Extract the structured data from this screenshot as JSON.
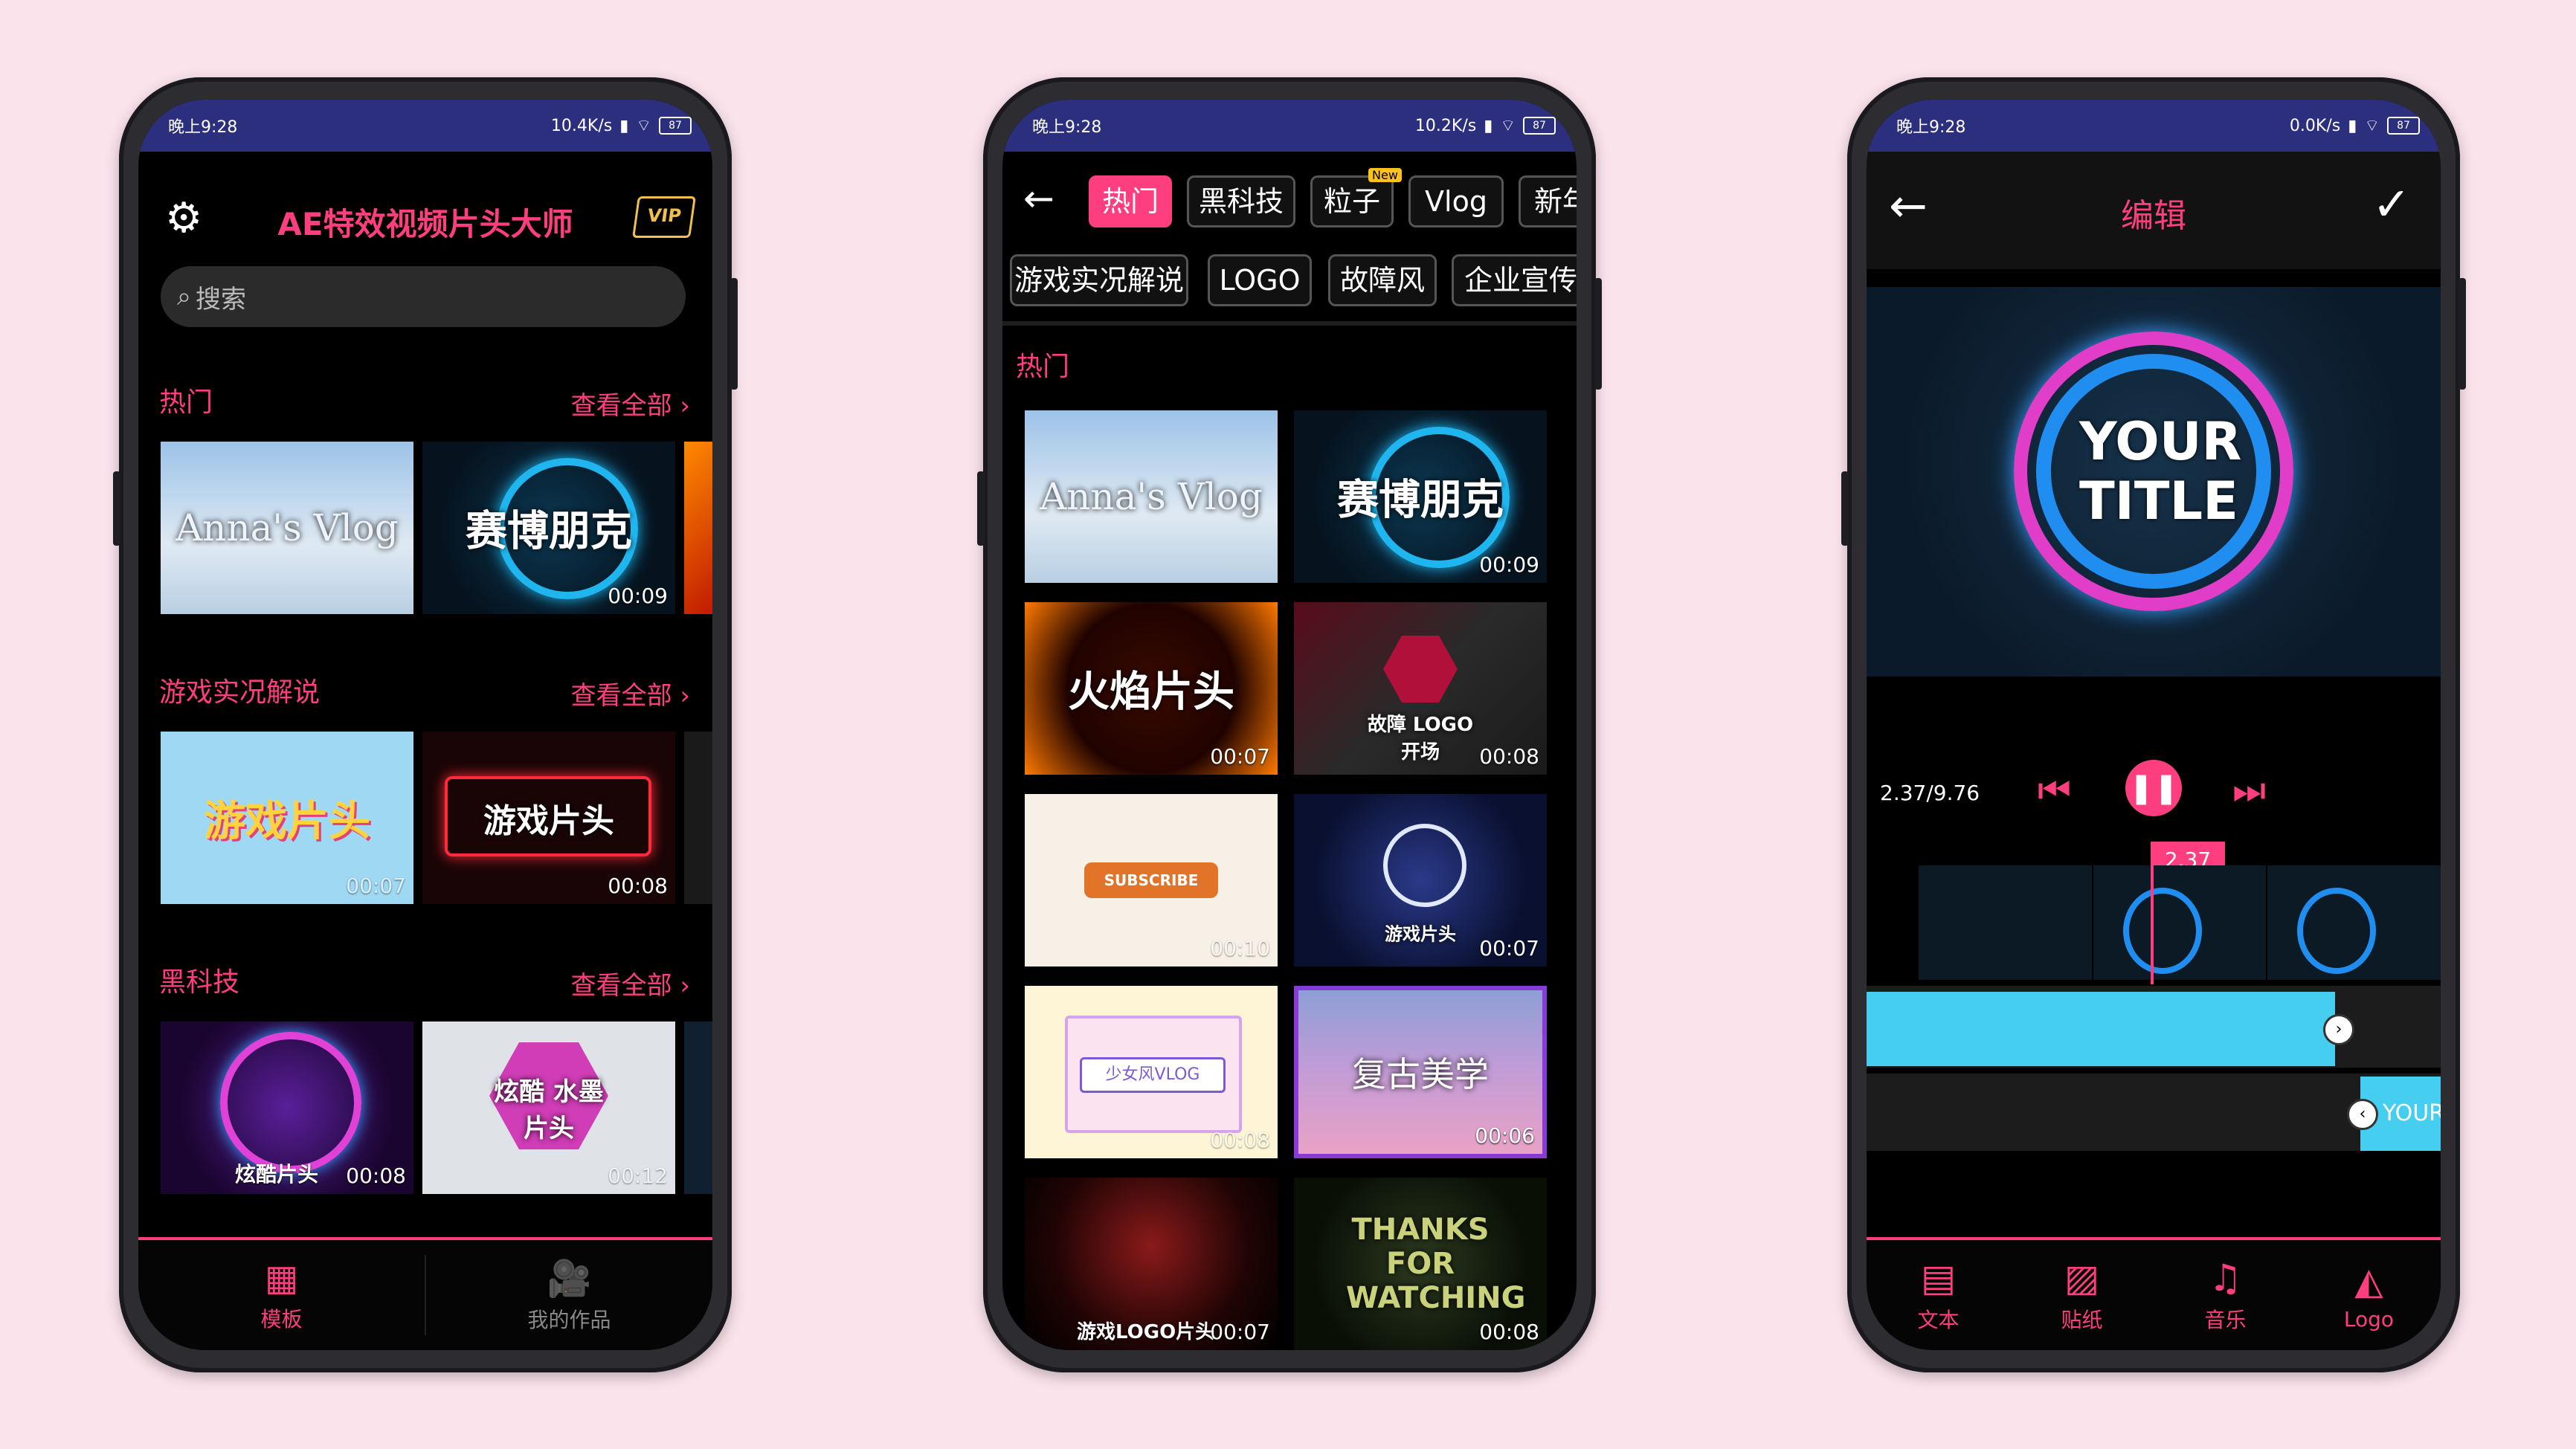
{
  "status": {
    "time": "晚上9:28",
    "speed1": "10.4K/s",
    "speed2": "10.2K/s",
    "speed3": "0.0K/s",
    "battery": "87"
  },
  "home": {
    "app_title": "AE特效视频片头大师",
    "vip_label": "VIP",
    "search_placeholder": "搜索",
    "sections": [
      {
        "title": "热门",
        "see_all": "查看全部"
      },
      {
        "title": "游戏实况解说",
        "see_all": "查看全部"
      },
      {
        "title": "黑科技",
        "see_all": "查看全部"
      }
    ],
    "thumbs": [
      {
        "title": "Anna's Vlog",
        "duration": ""
      },
      {
        "title": "赛博朋克",
        "duration": "00:09"
      },
      {
        "title": "游戏片头",
        "duration": "00:07"
      },
      {
        "title": "游戏片头",
        "duration": "00:08"
      },
      {
        "title": "炫酷片头",
        "duration": "00:08"
      },
      {
        "title": "炫酷 水墨片头",
        "duration": "00:12"
      }
    ],
    "nav": [
      {
        "label": "模板"
      },
      {
        "label": "我的作品"
      }
    ]
  },
  "category": {
    "chips_row1": [
      "热门",
      "黑科技",
      "粒子",
      "Vlog",
      "新年"
    ],
    "new_badge": "New",
    "chips_row2": [
      "游戏实况解说",
      "LOGO",
      "故障风",
      "企业宣传"
    ],
    "section_title": "热门",
    "grid": [
      {
        "title": "Anna's Vlog",
        "duration": ""
      },
      {
        "title": "赛博朋克",
        "duration": "00:09"
      },
      {
        "title": "火焰片头",
        "duration": "00:07"
      },
      {
        "title": "故障 LOGO开场",
        "duration": "00:08"
      },
      {
        "title": "SUBSCRIBE",
        "duration": "00:10"
      },
      {
        "title": "游戏片头",
        "duration": "00:07"
      },
      {
        "title": "少女风VLOG",
        "duration": "00:08"
      },
      {
        "title": "复古美学",
        "duration": "00:06"
      },
      {
        "title": "游戏LOGO片头",
        "duration": "00:07"
      },
      {
        "title": "THANKS FOR WATCHING",
        "duration": "00:08"
      }
    ]
  },
  "editor": {
    "title": "编辑",
    "preview_text": "YOUR TITLE",
    "time_readout": "2.37/9.76",
    "playhead_label": "2.37",
    "text_clip": "YOUR",
    "tools": [
      {
        "label": "文本"
      },
      {
        "label": "贴纸"
      },
      {
        "label": "音乐"
      },
      {
        "label": "Logo"
      }
    ]
  },
  "colors": {
    "accent": "#ff3e7f",
    "status_bar": "#2b2f7d",
    "cyan": "#46cef0"
  }
}
